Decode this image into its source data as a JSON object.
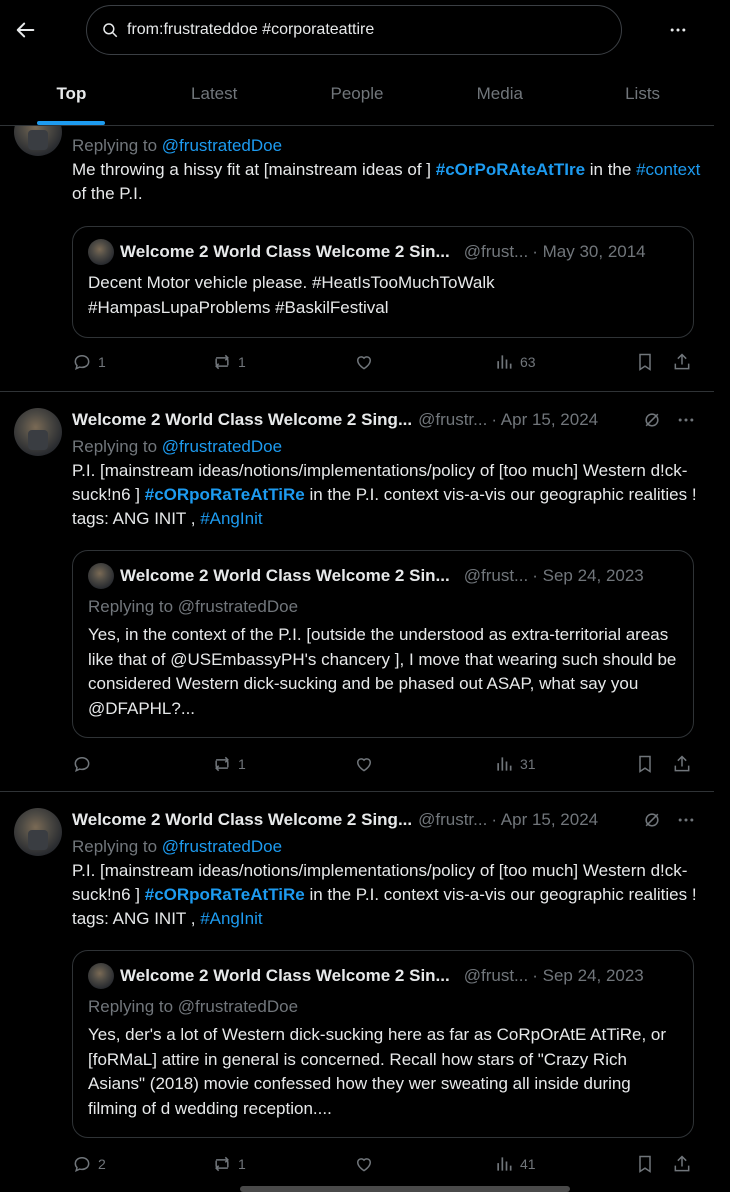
{
  "search": {
    "query": "from:frustrateddoe #corporateattire",
    "placeholder": "Search"
  },
  "tabs": [
    {
      "label": "Top"
    },
    {
      "label": "Latest"
    },
    {
      "label": "People"
    },
    {
      "label": "Media"
    },
    {
      "label": "Lists"
    }
  ],
  "colors": {
    "accent": "#1d9bf0",
    "muted": "#71767b",
    "text": "#e7e9ea",
    "background": "#000000",
    "border": "#2f3336"
  },
  "tweets": [
    {
      "reply_prefix": "Replying to",
      "reply_to": "@frustratedDoe",
      "body_1": "Me throwing a hissy fit at [mainstream ideas of ] ",
      "tag_1": "#cOrPoRAteAtTIre",
      "body_2": " in the ",
      "tag_2": "#context",
      "body_3": " of the P.I.",
      "quote": {
        "name": "Welcome 2 World Class Welcome 2 Sin...",
        "handle": "@frust...",
        "date": "· May 30, 2014",
        "text_line_1": "Decent  Motor vehicle please. #HeatIsTooMuchToWalk",
        "text_line_2": "#HampasLupaProblems #BaskilFestival"
      },
      "stats": {
        "replies": "1",
        "reposts": "1",
        "likes": "",
        "views": "63"
      }
    },
    {
      "name": "Welcome 2 World Class Welcome 2 Sing...",
      "handle": "@frustr...",
      "date": "· Apr 15, 2024",
      "reply_prefix": "Replying to",
      "reply_to": "@frustratedDoe",
      "body_1": "P.I. [mainstream ideas/notions/implementations/policy of [too much] Western d!ck-suck!n6 ] ",
      "tag_1": "#cORpoRaTeAtTiRe",
      "body_2": " in the P.I. context vis-a-vis our geographic realities !  tags: ANG INIT , ",
      "tag_2": "#AngInit",
      "quote": {
        "name": "Welcome 2 World Class Welcome 2 Sin...",
        "handle": "@frust...",
        "date": "· Sep 24, 2023",
        "reply": "Replying to @frustratedDoe",
        "text": "Yes, in the context of the P.I. [outside the understood as extra-territorial areas like that of @USEmbassyPH's chancery ], I move that wearing such should be considered Western dick-sucking and be phased out ASAP, what say you @DFAPHL?..."
      },
      "stats": {
        "replies": "",
        "reposts": "1",
        "likes": "",
        "views": "31"
      }
    },
    {
      "name": "Welcome 2 World Class Welcome 2 Sing...",
      "handle": "@frustr...",
      "date": "· Apr 15, 2024",
      "reply_prefix": "Replying to",
      "reply_to": "@frustratedDoe",
      "body_1": "P.I. [mainstream ideas/notions/implementations/policy of [too much] Western d!ck-suck!n6 ] ",
      "tag_1": "#cORpoRaTeAtTiRe",
      "body_2": " in the P.I. context vis-a-vis our geographic realities !  tags: ANG INIT , ",
      "tag_2": "#AngInit",
      "quote": {
        "name": "Welcome 2 World Class Welcome 2 Sin...",
        "handle": "@frust...",
        "date": "· Sep 24, 2023",
        "reply": "Replying to @frustratedDoe",
        "text": "Yes, der's a lot of Western dick-sucking here as far as CoRpOrAtE AtTiRe, or [foRMaL] attire in general is concerned. Recall how stars of \"Crazy Rich Asians\" (2018) movie confessed how they wer sweating all inside during filming of d wedding reception...."
      },
      "stats": {
        "replies": "2",
        "reposts": "1",
        "likes": "",
        "views": "41"
      }
    }
  ],
  "icons": {
    "back": "arrow-left-icon",
    "search": "search-icon",
    "more": "more-horizontal-icon",
    "reply": "reply-icon",
    "repost": "repost-icon",
    "like": "heart-icon",
    "views": "views-icon",
    "bookmark": "bookmark-icon",
    "share": "share-icon",
    "grok": "grok-icon"
  }
}
